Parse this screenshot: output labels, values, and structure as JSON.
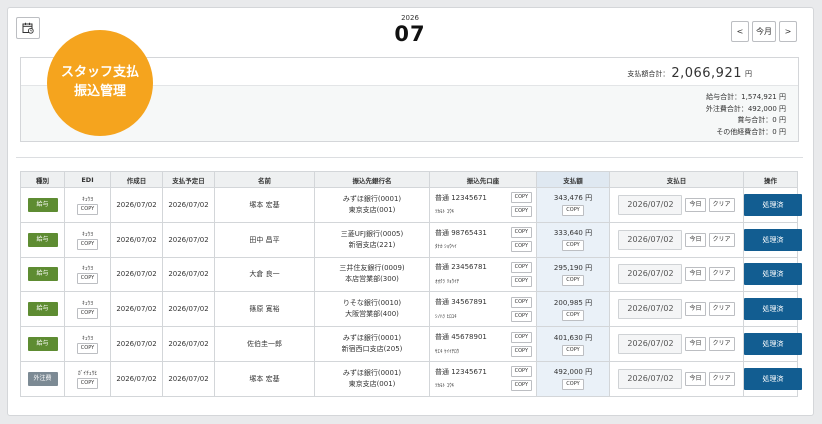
{
  "header": {
    "year": "2026",
    "month": "07",
    "prev_label": "<",
    "today_label": "今月",
    "next_label": ">"
  },
  "badge": {
    "line1": "スタッフ支払",
    "line2": "振込管理"
  },
  "summary": {
    "total_label": "支払額合計：",
    "total_amount": "2,066,921",
    "total_unit": "円",
    "lines": [
      "給与合計：1,574,921 円",
      "外注費合計：492,000 円",
      "賞与合計：0 円",
      "その他経費合計：0 円"
    ]
  },
  "table": {
    "headers": [
      "種別",
      "EDI",
      "作成日",
      "支払予定日",
      "名前",
      "振込先銀行名",
      "振込先口座",
      "支払額",
      "支払日",
      "操作"
    ],
    "copy_label": "COPY",
    "today_btn": "今日",
    "clear_btn": "クリア",
    "action_label": "処理済",
    "rows": [
      {
        "type": "給与",
        "type_color": "green",
        "edi": "ｷｭｳﾖ",
        "created": "2026/07/02",
        "scheduled": "2026/07/02",
        "name": "塚本 宏基",
        "bank1": "みずほ銀行(0001)",
        "bank2": "東京支店(001)",
        "account": "普通 12345671",
        "account_kana": "ﾂｶﾓﾄ ｺｳｷ",
        "amount": "343,476 円",
        "paydate": "2026/07/02"
      },
      {
        "type": "給与",
        "type_color": "green",
        "edi": "ｷｭｳﾖ",
        "created": "2026/07/02",
        "scheduled": "2026/07/02",
        "name": "田中 昌平",
        "bank1": "三菱UFJ銀行(0005)",
        "bank2": "新宿支店(221)",
        "account": "普通 98765431",
        "account_kana": "ﾀﾅｶ ｼｮｳﾍｲ",
        "amount": "333,640 円",
        "paydate": "2026/07/02"
      },
      {
        "type": "給与",
        "type_color": "green",
        "edi": "ｷｭｳﾖ",
        "created": "2026/07/02",
        "scheduled": "2026/07/02",
        "name": "大倉 良一",
        "bank1": "三井住友銀行(0009)",
        "bank2": "本店営業部(300)",
        "account": "普通 23456781",
        "account_kana": "ｵｵｸﾗ ﾘｮｳｲﾁ",
        "amount": "295,190 円",
        "paydate": "2026/07/02"
      },
      {
        "type": "給与",
        "type_color": "green",
        "edi": "ｷｭｳﾖ",
        "created": "2026/07/02",
        "scheduled": "2026/07/02",
        "name": "篠原 寛裕",
        "bank1": "りそな銀行(0010)",
        "bank2": "大阪営業部(400)",
        "account": "普通 34567891",
        "account_kana": "ｼﾉﾊﾗ ﾋﾛﾕｷ",
        "amount": "200,985 円",
        "paydate": "2026/07/02"
      },
      {
        "type": "給与",
        "type_color": "green",
        "edi": "ｷｭｳﾖ",
        "created": "2026/07/02",
        "scheduled": "2026/07/02",
        "name": "佐伯圭一郎",
        "bank1": "みずほ銀行(0001)",
        "bank2": "新宿西口支店(205)",
        "account": "普通 45678901",
        "account_kana": "ｻｴｷ ｹｲｲﾁﾛｳ",
        "amount": "401,630 円",
        "paydate": "2026/07/02"
      },
      {
        "type": "外注費",
        "type_color": "gray",
        "edi": "ｶﾞｲﾁｭｳﾋ",
        "created": "2026/07/02",
        "scheduled": "2026/07/02",
        "name": "塚本 宏基",
        "bank1": "みずほ銀行(0001)",
        "bank2": "東京支店(001)",
        "account": "普通 12345671",
        "account_kana": "ﾂｶﾓﾄ ｺｳｷ",
        "amount": "492,000 円",
        "paydate": "2026/07/02"
      }
    ]
  }
}
